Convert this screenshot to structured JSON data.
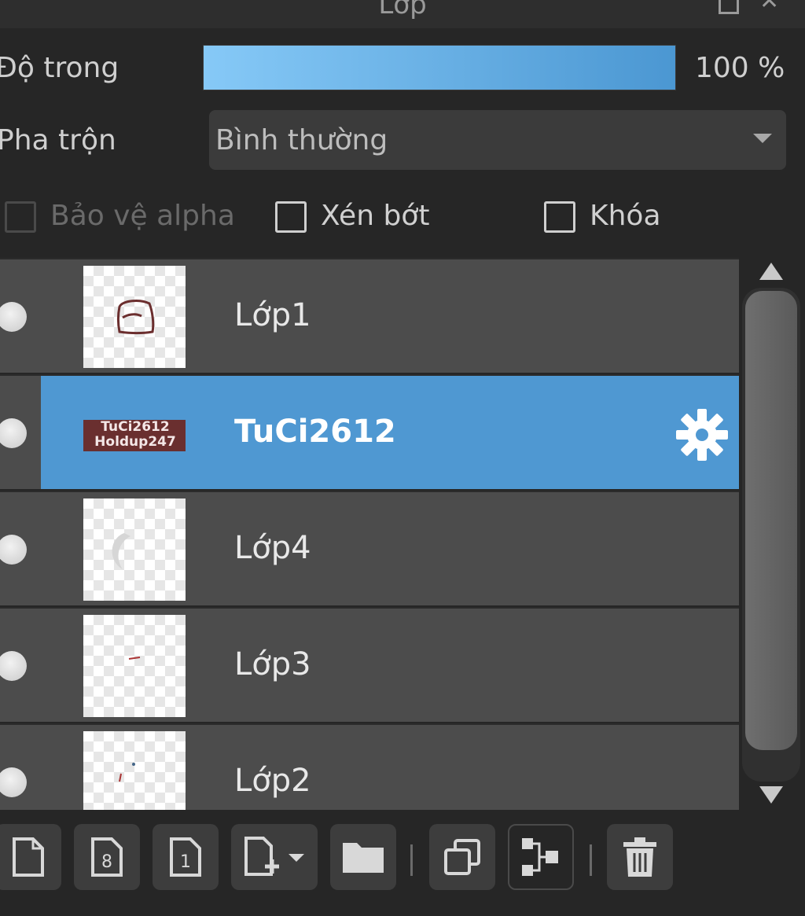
{
  "panel": {
    "title": "Lớp"
  },
  "opacity": {
    "label": "Độ trong",
    "value_text": "100 %",
    "level_percent": 100
  },
  "blend": {
    "label": "Pha trộn",
    "selected": "Bình thường"
  },
  "checkboxes": [
    {
      "label": "Bảo vệ alpha",
      "checked": false,
      "enabled": false
    },
    {
      "label": "Xén bớt",
      "checked": false,
      "enabled": true
    },
    {
      "label": "Khóa",
      "checked": false,
      "enabled": true
    }
  ],
  "layers": [
    {
      "name": "Lớp1",
      "selected": false,
      "visible": true,
      "thumb": "sketch"
    },
    {
      "name": "TuCi2612",
      "selected": true,
      "visible": true,
      "thumb": "text",
      "thumb_text": "TuCi2612 Holdup247",
      "has_settings": true
    },
    {
      "name": "Lớp4",
      "selected": false,
      "visible": true,
      "thumb": "moon"
    },
    {
      "name": "Lớp3",
      "selected": false,
      "visible": true,
      "thumb": "dot"
    },
    {
      "name": "Lớp2",
      "selected": false,
      "visible": true,
      "thumb": "dots"
    }
  ],
  "toolbar": {
    "buttons": [
      "new-layer-icon",
      "new-8bit-layer-icon",
      "new-1bit-layer-icon",
      "new-layer-menu-icon",
      "new-folder-icon",
      "duplicate-layer-icon",
      "merge-layer-icon",
      "delete-layer-icon"
    ]
  },
  "colors": {
    "selection": "#4f98d2",
    "row": "#4c4c4c",
    "background": "#262626"
  }
}
